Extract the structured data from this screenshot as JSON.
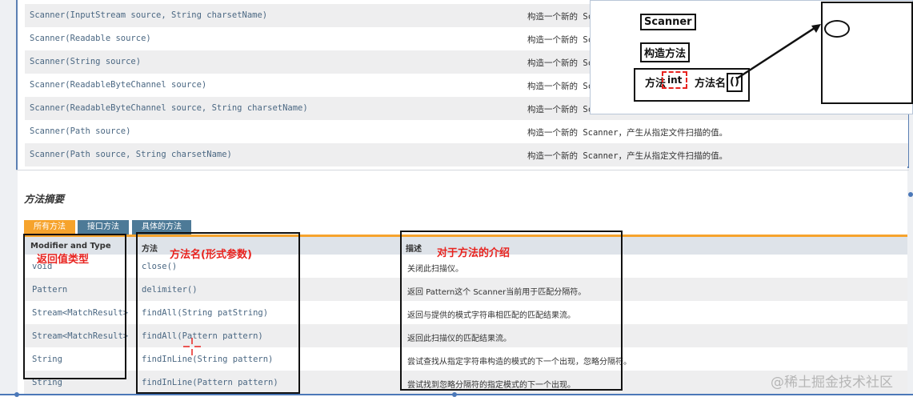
{
  "constructors": [
    {
      "sig_name": "Scanner(InputStream source, ",
      "sig_type": "String",
      "sig_rest": " charsetName)",
      "desc": "构造一个新的 Sc"
    },
    {
      "sig_name": "Scanner(Readable source)",
      "sig_type": "",
      "sig_rest": "",
      "desc": "构造一个新的 Sc"
    },
    {
      "sig_name": "Scanner(String source)",
      "sig_type": "",
      "sig_rest": "",
      "desc": "构造一个新的 Sc"
    },
    {
      "sig_name": "Scanner(ReadableByteChannel source)",
      "sig_type": "",
      "sig_rest": "",
      "desc": "构造一个新的 Sc"
    },
    {
      "sig_name": "Scanner(ReadableByteChannel source, ",
      "sig_type": "String",
      "sig_rest": " charsetName)",
      "desc": "构造一个新的 Sc"
    },
    {
      "sig_name": "Scanner(Path source)",
      "sig_type": "",
      "sig_rest": "",
      "desc": "构造一个新的 Scanner，产生从指定文件扫描的值。"
    },
    {
      "sig_name": "Scanner(Path source, ",
      "sig_type": "String",
      "sig_rest": " charsetName)",
      "desc": "构造一个新的 Scanner，产生从指定文件扫描的值。"
    }
  ],
  "method_summary": {
    "title": "方法摘要",
    "tabs": [
      "所有方法",
      "接口方法",
      "具体的方法"
    ],
    "headers": {
      "modifier": "Modifier and Type",
      "method": "方法",
      "desc": "描述"
    },
    "rows": [
      {
        "ret": "void",
        "method": "close()",
        "desc": "关闭此扫描仪。"
      },
      {
        "ret": "Pattern",
        "method": "delimiter()",
        "desc": "返回 Pattern这个 Scanner当前用于匹配分隔符。"
      },
      {
        "ret": "Stream<MatchResult>",
        "method": "findAll(String patString)",
        "desc": "返回与提供的模式字符串相匹配的匹配结果流。"
      },
      {
        "ret": "Stream<MatchResult>",
        "method": "findAll(Pattern pattern)",
        "desc": "返回此扫描仪的匹配结果流。"
      },
      {
        "ret": "String",
        "method": "findInLine(String pattern)",
        "desc": "尝试查找从指定字符串构造的模式的下一个出现，忽略分隔符。"
      },
      {
        "ret": "String",
        "method": "findInLine(Pattern pattern)",
        "desc": "尝试找到忽略分隔符的指定模式的下一个出现。"
      }
    ]
  },
  "annotations": {
    "return_type": "返回值类型",
    "method_name": "方法名(形式参数)",
    "method_intro": "对于方法的介绍"
  },
  "popup": {
    "scanner": "Scanner",
    "ctor": "构造方法",
    "method": "方法",
    "int_text": "int",
    "method_name": "方法名",
    "parens": "()"
  },
  "watermark": "@稀土掘金技术社区",
  "colors": {
    "accent_orange": "#f6a32c",
    "tab_blue": "#4d7a97",
    "annotation_red": "#e8231f",
    "link": "#4a6782"
  }
}
